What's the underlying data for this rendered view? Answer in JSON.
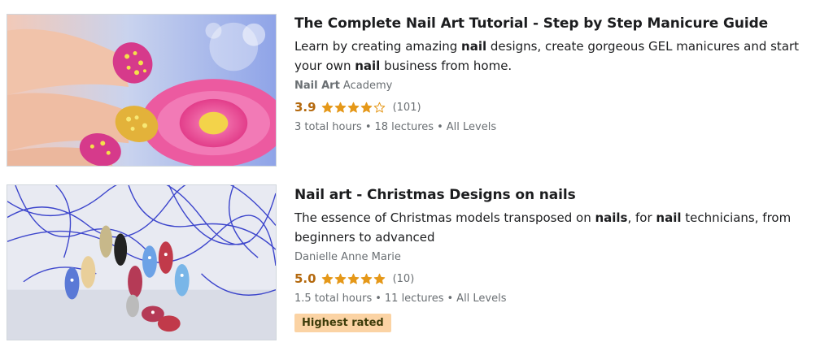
{
  "courses": [
    {
      "title": "The Complete Nail Art Tutorial - Step by Step Manicure Guide",
      "headline": [
        {
          "text": "Learn by creating amazing ",
          "bold": false
        },
        {
          "text": "nail",
          "bold": true
        },
        {
          "text": " designs, create gorgeous GEL manicures and start your own ",
          "bold": false
        },
        {
          "text": "nail",
          "bold": true
        },
        {
          "text": " business from home.",
          "bold": false
        }
      ],
      "instructor": [
        {
          "text": "Nail Art",
          "bold": true
        },
        {
          "text": " Academy",
          "bold": false
        }
      ],
      "rating": "3.9",
      "rating_stars": 3.9,
      "rating_count": "(101)",
      "meta": [
        "3 total hours",
        "18 lectures",
        "All Levels"
      ],
      "badge": "",
      "thumbnail_icon": "nail-art-pink-flower-image"
    },
    {
      "title": "Nail art - Christmas Designs on nails",
      "headline": [
        {
          "text": "The essence of Christmas models transposed on ",
          "bold": false
        },
        {
          "text": "nails",
          "bold": true
        },
        {
          "text": ", for ",
          "bold": false
        },
        {
          "text": "nail",
          "bold": true
        },
        {
          "text": " technicians, from beginners to advanced",
          "bold": false
        }
      ],
      "instructor": [
        {
          "text": "Danielle Anne Marie",
          "bold": false
        }
      ],
      "rating": "5.0",
      "rating_stars": 5.0,
      "rating_count": "(10)",
      "meta": [
        "1.5 total hours",
        "11 lectures",
        "All Levels"
      ],
      "badge": "Highest rated",
      "thumbnail_icon": "christmas-nail-tips-image"
    }
  ],
  "colors": {
    "rating": "#b4690e",
    "star": "#e59819",
    "badge_bg": "#fbd3a4",
    "muted": "#6a6f73"
  }
}
